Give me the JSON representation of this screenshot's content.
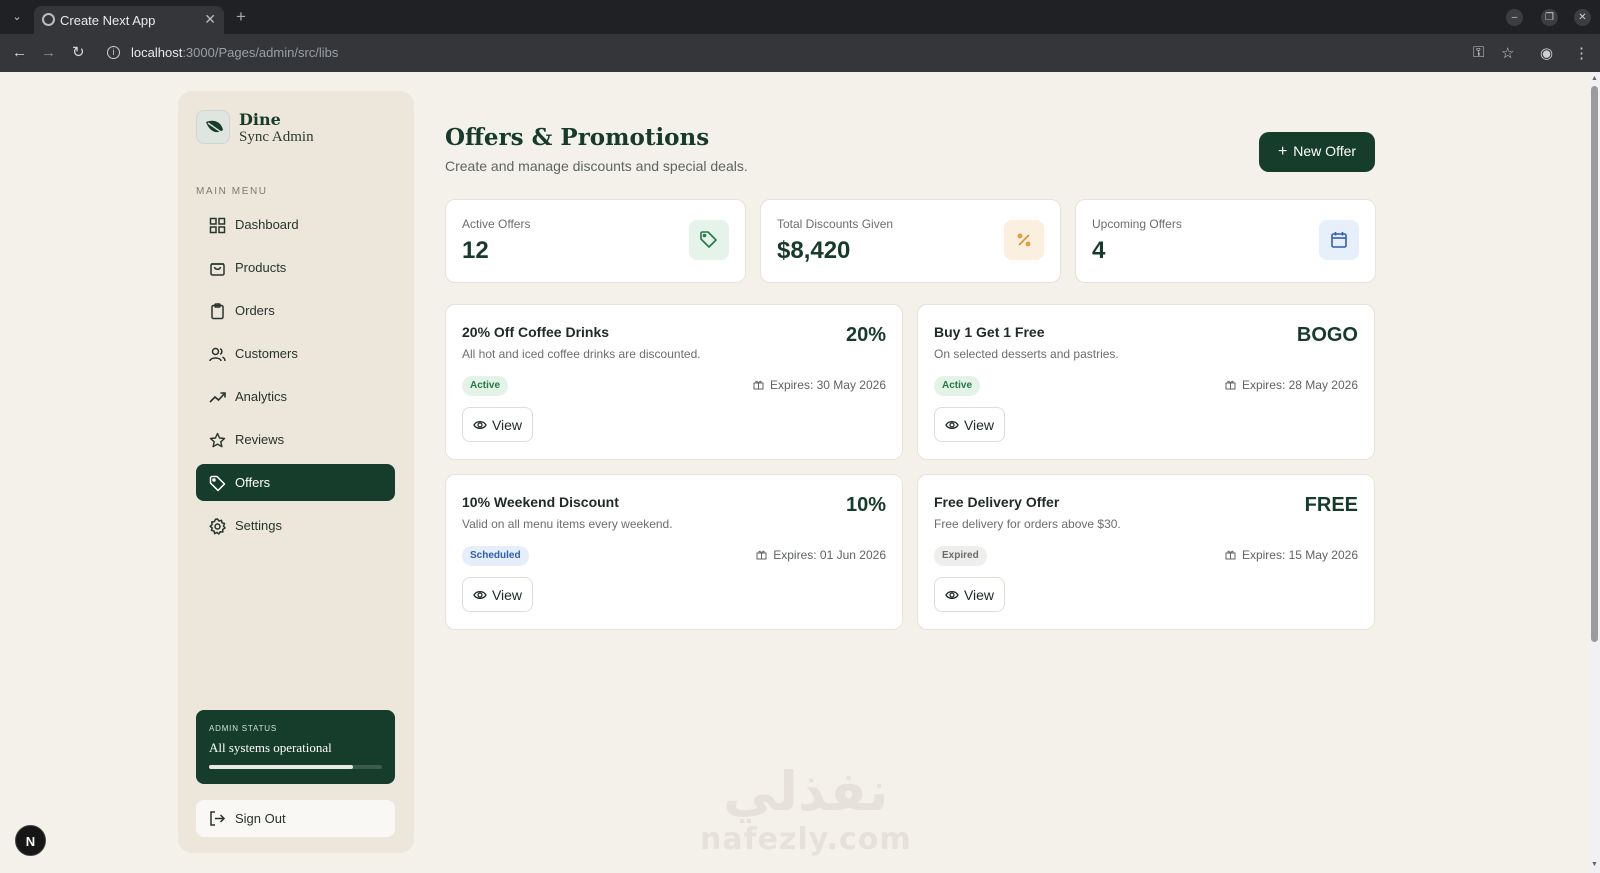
{
  "browser": {
    "tab_title": "Create Next App",
    "url_host": "localhost",
    "url_rest": ":3000/Pages/admin/src/libs"
  },
  "sidebar": {
    "brand_line1": "Dine",
    "brand_line2": "Sync Admin",
    "menu_title": "MAIN MENU",
    "items": [
      {
        "label": "Dashboard",
        "icon": "grid-icon"
      },
      {
        "label": "Products",
        "icon": "bag-icon"
      },
      {
        "label": "Orders",
        "icon": "clipboard-icon"
      },
      {
        "label": "Customers",
        "icon": "users-icon"
      },
      {
        "label": "Analytics",
        "icon": "trending-up-icon"
      },
      {
        "label": "Reviews",
        "icon": "star-icon"
      },
      {
        "label": "Offers",
        "icon": "tag-icon",
        "active": true
      },
      {
        "label": "Settings",
        "icon": "gear-icon"
      }
    ],
    "status": {
      "title": "ADMIN STATUS",
      "message": "All systems operational",
      "progress": 0.83
    },
    "signout_label": "Sign Out"
  },
  "header": {
    "title": "Offers & Promotions",
    "subtitle": "Create and manage discounts and special deals.",
    "new_offer_label": "New Offer"
  },
  "stats": [
    {
      "label": "Active Offers",
      "value": "12",
      "icon": "tag-icon",
      "color": "#237a45"
    },
    {
      "label": "Total Discounts Given",
      "value": "$8,420",
      "icon": "percent-icon",
      "color": "#e0902a"
    },
    {
      "label": "Upcoming Offers",
      "value": "4",
      "icon": "calendar-icon",
      "color": "#2f5fb0"
    }
  ],
  "offers": [
    {
      "name": "20% Off Coffee Drinks",
      "description": "All hot and iced coffee drinks are discounted.",
      "value": "20%",
      "status": "Active",
      "expires": "Expires: 30 May 2026",
      "view_label": "View"
    },
    {
      "name": "Buy 1 Get 1 Free",
      "description": "On selected desserts and pastries.",
      "value": "BOGO",
      "status": "Active",
      "expires": "Expires: 28 May 2026",
      "view_label": "View"
    },
    {
      "name": "10% Weekend Discount",
      "description": "Valid on all menu items every weekend.",
      "value": "10%",
      "status": "Scheduled",
      "expires": "Expires: 01 Jun 2026",
      "view_label": "View"
    },
    {
      "name": "Free Delivery Offer",
      "description": "Free delivery for orders above $30.",
      "value": "FREE",
      "status": "Expired",
      "expires": "Expires: 15 May 2026",
      "view_label": "View"
    }
  ],
  "watermark": {
    "arabic": "نفذلي",
    "latin": "nafezly.com"
  },
  "colors": {
    "primary": "#163d2c",
    "background": "#f4f1ea",
    "sidebar": "#ede7db"
  }
}
